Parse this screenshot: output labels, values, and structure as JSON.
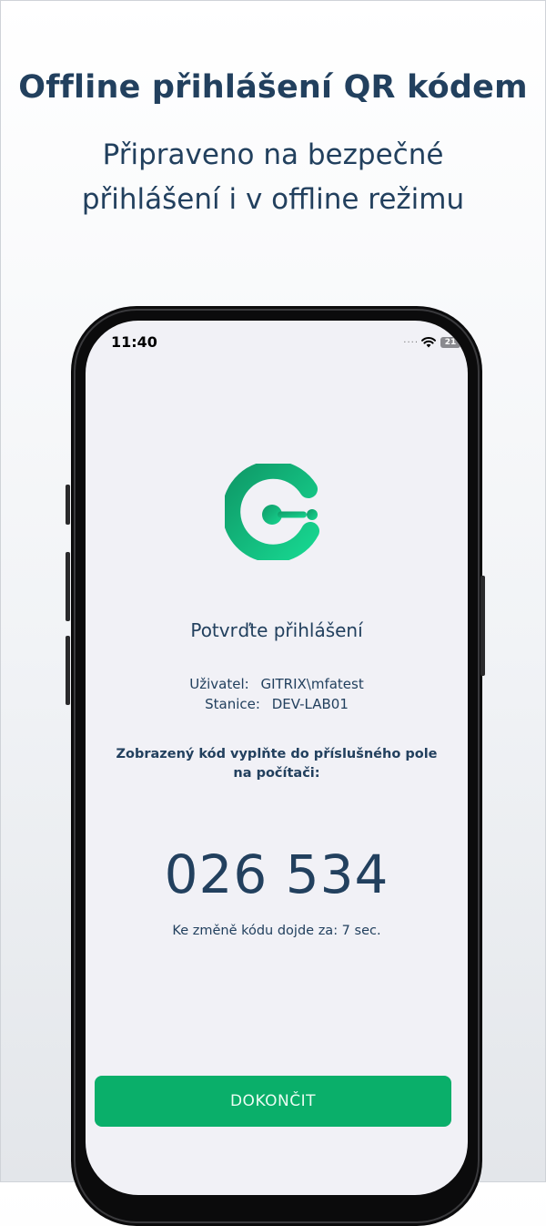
{
  "headline": "Offline přihlášení QR kódem",
  "subhead": "Připraveno na bezpečné přihlášení i v offline režimu",
  "status_bar": {
    "time": "11:40",
    "signal": "····",
    "battery": "21"
  },
  "screen": {
    "title": "Potvrďte přihlášení",
    "user_label": "Uživatel:",
    "user_value": "GITRIX\\mfatest",
    "station_label": "Stanice:",
    "station_value": "DEV-LAB01",
    "instruction": "Zobrazený kód vyplňte do příslušného pole na počítači:",
    "code": "026 534",
    "countdown": "Ke změně kódu dojde za: 7 sec.",
    "finish_label": "DOKONČIT"
  },
  "colors": {
    "text": "#22405e",
    "accent": "#0aaf6a",
    "logo_gradient_start": "#0f9a68",
    "logo_gradient_end": "#17d690"
  }
}
